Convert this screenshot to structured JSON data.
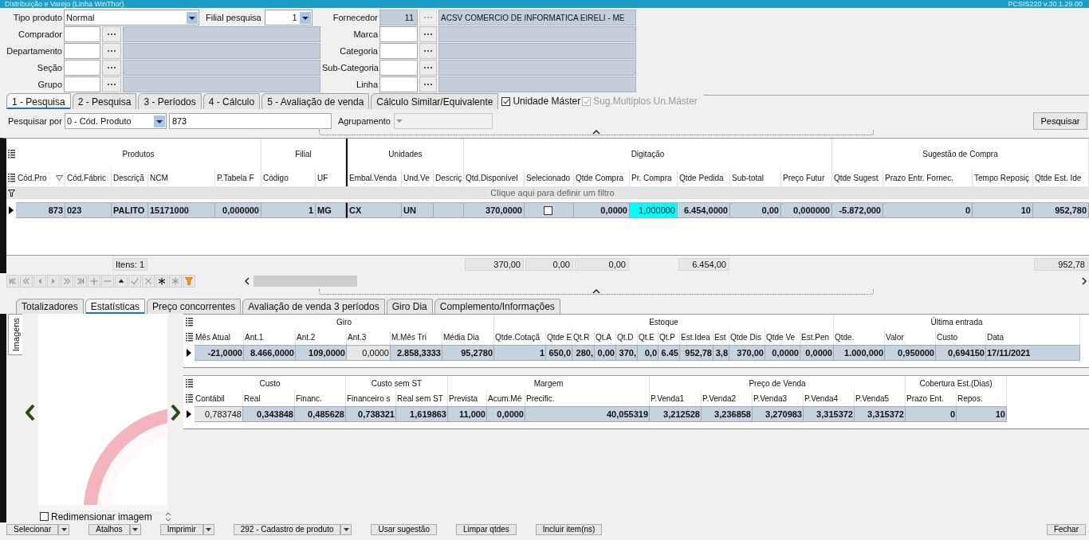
{
  "window": {
    "title": "Distribuição e Varejo (Linha WinThor)",
    "version": "PCSIS220  v.30.1.29.00"
  },
  "form": {
    "tipo_produto": {
      "label": "Tipo produto",
      "value": "Normal"
    },
    "filial_pesquisa": {
      "label": "Filial pesquisa",
      "value": "1"
    },
    "fornecedor": {
      "label": "Fornecedor",
      "code": "11",
      "name": "ACSV COMERCIO DE INFORMATICA EIRELI - ME",
      "disabled": true
    },
    "left_fields": [
      {
        "label": "Comprador"
      },
      {
        "label": "Departamento"
      },
      {
        "label": "Seção"
      },
      {
        "label": "Grupo"
      }
    ],
    "right_fields": [
      {
        "label": "Marca"
      },
      {
        "label": "Categoria"
      },
      {
        "label": "Sub-Categoria"
      },
      {
        "label": "Linha"
      }
    ]
  },
  "tabs": [
    {
      "label": "1 - Pesquisa",
      "selected": true
    },
    {
      "label": "2 - Pesquisa",
      "selected": false
    },
    {
      "label": "3 - Períodos",
      "selected": false
    },
    {
      "label": "4 - Cálculo",
      "selected": false
    },
    {
      "label": "5 - Avaliação de venda",
      "selected": false
    },
    {
      "label": "Cálculo Similar/Equivalente",
      "selected": false
    }
  ],
  "options": [
    {
      "label": "Unidade Máster",
      "checked": true,
      "disabled": false
    },
    {
      "label": "Sug.Multiplos Un.Máster",
      "checked": true,
      "disabled": true
    }
  ],
  "search": {
    "label": "Pesquisar por",
    "mode": "0 - Cód. Produto",
    "value": "873",
    "group_label": "Agrupamento",
    "group_disabled": true,
    "button": "Pesquisar"
  },
  "products_grid": {
    "groups": [
      {
        "label": "Produtos",
        "columns": [
          {
            "label": "Cód.Pro",
            "sorted": true
          },
          {
            "label": "Cód.Fábric"
          },
          {
            "label": "Descriçã",
            "footer": "Itens: 1"
          },
          {
            "label": "NCM"
          },
          {
            "label": "P.Tabela F"
          }
        ]
      },
      {
        "label": "Filial",
        "columns": [
          {
            "label": "Código"
          },
          {
            "label": "UF"
          }
        ]
      },
      {
        "label": "Unidades",
        "columns": [
          {
            "label": "Embal.Venda"
          },
          {
            "label": "Und.Ve"
          },
          {
            "label": "Descriç"
          }
        ]
      },
      {
        "label": "Digitação",
        "columns": [
          {
            "label": "Qtd.Disponível",
            "footer": "370,00"
          },
          {
            "label": "Selecionado",
            "footer": "0,00"
          },
          {
            "label": "Qtde Compra",
            "footer": "0,00"
          },
          {
            "label": "Pr. Compra"
          },
          {
            "label": "Qtde Pedida",
            "footer": "6.454,00"
          },
          {
            "label": "Sub-total"
          },
          {
            "label": "Preço Futur"
          }
        ]
      },
      {
        "label": "Sugestão de Compra",
        "columns": [
          {
            "label": "Qtde Sugest"
          },
          {
            "label": "Prazo Entr. Fornec."
          },
          {
            "label": "Tempo Reposiç"
          },
          {
            "label": "Qtde Est. Ide",
            "footer": "952,78"
          }
        ]
      }
    ],
    "filter_hint": "Clique aqui para definir um filtro",
    "rows": [
      {
        "selected": true,
        "cells": [
          "873",
          "023",
          "PALITO",
          "15171000",
          "0,000000",
          "1",
          "MG",
          "CX",
          "UN",
          {
            "kind": "blank"
          },
          "370,0000",
          {
            "kind": "checkbox",
            "checked": false
          },
          "0,0000",
          {
            "kind": "editing",
            "text": "1,000000"
          },
          "6.454,0000",
          "0,00",
          "0,000000",
          "-5.872,000",
          "0",
          "10",
          "952,780"
        ]
      }
    ]
  },
  "bottom_tabs": [
    {
      "label": "Totalizadores",
      "selected": false
    },
    {
      "label": "Estatísticas",
      "selected": true
    },
    {
      "label": "Preço concorrentes",
      "selected": false
    },
    {
      "label": "Avaliação de venda 3 períodos",
      "selected": false
    },
    {
      "label": "Giro Dia",
      "selected": false
    },
    {
      "label": "Complemento/Informações",
      "selected": false
    }
  ],
  "image_panel": {
    "tab": "Imagens",
    "resize": {
      "label": "Redimensionar imagem",
      "checked": false
    }
  },
  "stats_grid": {
    "groups": [
      {
        "label": "Giro",
        "columns": [
          {
            "label": "Mês Atual"
          },
          {
            "label": "Ant.1"
          },
          {
            "label": "Ant.2"
          },
          {
            "label": "Ant.3"
          },
          {
            "label": "M.Mês Tri"
          },
          {
            "label": "Média Dia"
          }
        ]
      },
      {
        "label": "Estoque",
        "columns": [
          {
            "label": "Qtde.Cotaçã"
          },
          {
            "label": "Qtde E"
          },
          {
            "label": "Qt.R"
          },
          {
            "label": "Qt.A"
          },
          {
            "label": "Qt.D"
          },
          {
            "label": "Qt.E"
          },
          {
            "label": "Qt.P"
          },
          {
            "label": "Est.Idea"
          },
          {
            "label": "Est"
          },
          {
            "label": "Qtde Dis"
          },
          {
            "label": "Qtde Ve"
          },
          {
            "label": "Est.Pen"
          }
        ]
      },
      {
        "label": "Última entrada",
        "columns": [
          {
            "label": "Qtde."
          },
          {
            "label": "Valor"
          },
          {
            "label": "Custo"
          },
          {
            "label": "Data"
          }
        ]
      }
    ],
    "rows": [
      {
        "selected": true,
        "cells": [
          "-21,0000",
          "8.466,0000",
          "109,0000",
          {
            "kind": "plain",
            "text": "0,0000"
          },
          "2.858,3333",
          "95,2780",
          "1",
          "650,0",
          "280,",
          "0,00",
          "370,",
          "0,0",
          "6.45",
          "952,78",
          "3,8",
          "370,00",
          "0,0000",
          "0,0000",
          "1.000,000",
          "0,950000",
          "0,694150",
          "17/11/2021"
        ]
      }
    ]
  },
  "cost_grid": {
    "groups": [
      {
        "label": "Custo",
        "columns": [
          {
            "label": "Contábil"
          },
          {
            "label": "Real"
          },
          {
            "label": "Financ."
          }
        ]
      },
      {
        "label": "Custo sem ST",
        "columns": [
          {
            "label": "Financeiro s"
          },
          {
            "label": "Real sem ST"
          }
        ]
      },
      {
        "label": "Margem",
        "columns": [
          {
            "label": "Prevista"
          },
          {
            "label": "Acum.Mé"
          },
          {
            "label": "Precific."
          }
        ]
      },
      {
        "label": "Preço de Venda",
        "columns": [
          {
            "label": "P.Venda1"
          },
          {
            "label": "P.Venda2"
          },
          {
            "label": "P.Venda3"
          },
          {
            "label": "P.Venda4"
          },
          {
            "label": "P.Venda5"
          }
        ]
      },
      {
        "label": "Cobertura Est.(Dias)",
        "columns": [
          {
            "label": "Prazo Ent."
          },
          {
            "label": "Repos."
          }
        ]
      }
    ],
    "rows": [
      {
        "selected": true,
        "cells": [
          {
            "kind": "plain",
            "text": "0,783748"
          },
          "0,343848",
          "0,485628",
          "0,738321",
          "1,619863",
          "11,000",
          "0,0000",
          "40,055319",
          "3,212528",
          "3,236858",
          "3,270983",
          "3,315372",
          "3,315372",
          "0",
          "10"
        ]
      }
    ]
  },
  "buttons": [
    {
      "label": "Selecionar",
      "split": true
    },
    {
      "label": "Atalhos",
      "split": true
    },
    {
      "label": "Imprimir",
      "split": true
    },
    {
      "label": "292 - Cadastro de produto",
      "split": true
    },
    {
      "label": "Usar sugestão",
      "split": false
    },
    {
      "label": "Limpar qtdes",
      "split": false
    },
    {
      "label": "Incluir item(ns)",
      "split": false
    },
    {
      "label": "Fechar",
      "split": false
    }
  ]
}
